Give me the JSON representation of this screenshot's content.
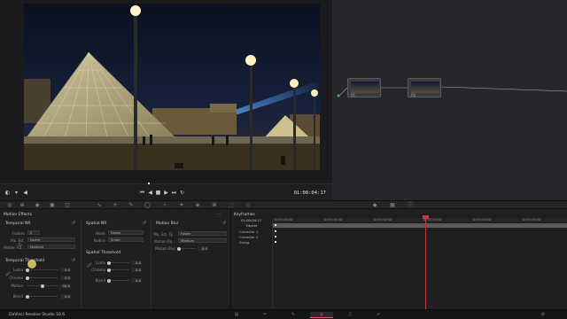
{
  "viewer": {
    "timecode": "01:00:04:17"
  },
  "node_editor": {
    "nodes": [
      {
        "label": "01"
      },
      {
        "label": "02"
      }
    ]
  },
  "motion_effects": {
    "title": "Motion Effects",
    "temporal_nr": {
      "title": "Temporal NR",
      "frames_label": "Frames",
      "frames_value": "0",
      "mo_est_label": "Mo. Est. Ty...",
      "mo_est_value": "Faster",
      "motion_range_label": "Motion Ra...",
      "motion_range_value": "Medium"
    },
    "spatial_nr": {
      "title": "Spatial NR",
      "mode_label": "Mode",
      "mode_value": "Faster",
      "radius_label": "Radius",
      "radius_value": "Small",
      "threshold_title": "Spatial Threshold",
      "luma_label": "Luma",
      "luma_value": "0.0",
      "chroma_label": "Chroma",
      "chroma_value": "0.0",
      "blend_label": "Blend",
      "blend_value": "0.0"
    },
    "motion_blur": {
      "title": "Motion Blur",
      "mo_est_label": "Mo. Est. Ty...",
      "mo_est_value": "Faster",
      "motion_range_label": "Motion Ra...",
      "motion_range_value": "Medium",
      "blur_label": "Motion Blur",
      "blur_value": "0.0"
    },
    "temporal_threshold": {
      "title": "Temporal Threshold",
      "luma_label": "Luma",
      "luma_value": "0.0",
      "chroma_label": "Chroma",
      "chroma_value": "0.0",
      "motion_label": "Motion",
      "motion_value": "50.0",
      "blend_label": "Blend",
      "blend_value": "0.0"
    }
  },
  "keyframes": {
    "title": "Keyframes",
    "timecode": "01:00:04:17",
    "rows": [
      "Master",
      "Corrector 1",
      "Corrector 2",
      "Sizing"
    ],
    "ruler": [
      "01:00:00:00",
      "01:00:01:00",
      "01:00:02:00",
      "01:00:03:00",
      "01:00:04:00",
      "01:00:05:00"
    ]
  },
  "status_bar": {
    "brand": "DaVinci Resolve Studio 18.6"
  }
}
